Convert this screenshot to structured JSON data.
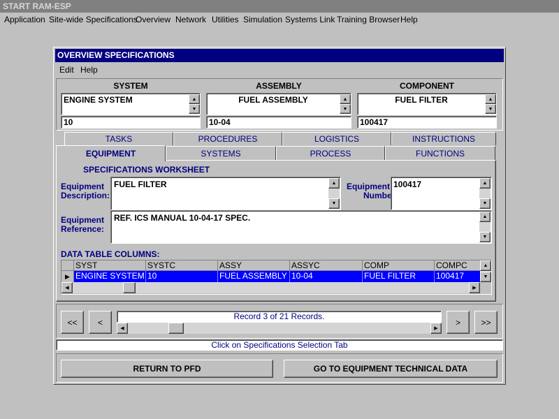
{
  "app": {
    "title": "START RAM-ESP"
  },
  "menu": [
    "Application",
    "Site-wide Specifications",
    "Overview",
    "Network",
    "Utilities",
    "Simulation",
    "Systems Link",
    "Training Browser",
    "Help"
  ],
  "window": {
    "title": "OVERVIEW SPECIFICATIONS",
    "menu": [
      "Edit",
      "Help"
    ]
  },
  "header": {
    "system": {
      "label": "SYSTEM",
      "name": "ENGINE SYSTEM",
      "code": "10"
    },
    "assembly": {
      "label": "ASSEMBLY",
      "name": "FUEL ASSEMBLY",
      "code": "10-04"
    },
    "component": {
      "label": "COMPONENT",
      "name": "FUEL FILTER",
      "code": "100417"
    }
  },
  "tabs_back": [
    "TASKS",
    "PROCEDURES",
    "LOGISTICS",
    "INSTRUCTIONS"
  ],
  "tabs_front": [
    "EQUIPMENT",
    "SYSTEMS",
    "PROCESS",
    "FUNCTIONS"
  ],
  "worksheet": {
    "title": "SPECIFICATIONS WORKSHEET",
    "equip_desc_label_1": "Equipment",
    "equip_desc_label_2": "Description:",
    "equip_desc_value": "FUEL FILTER",
    "equip_num_label_1": "Equipment",
    "equip_num_label_2": "Number:",
    "equip_num_value": "100417",
    "equip_ref_label_1": "Equipment",
    "equip_ref_label_2": "Reference:",
    "equip_ref_value": "REF. ICS MANUAL 10-04-17 SPEC."
  },
  "data_table": {
    "title": "DATA TABLE COLUMNS:",
    "columns": [
      "SYST",
      "SYSTC",
      "ASSY",
      "ASSYC",
      "COMP",
      "COMPC"
    ],
    "row": [
      "ENGINE SYSTEM",
      "10",
      "FUEL ASSEMBLY",
      "10-04",
      "FUEL FILTER",
      "100417"
    ]
  },
  "navigator": {
    "first": "<<",
    "prev": "<",
    "next": ">",
    "last": ">>",
    "record_text": "Record 3 of 21 Records.",
    "position_fraction": 0.14
  },
  "status": {
    "text": "Click on Specifications Selection Tab"
  },
  "buttons": {
    "return": "RETURN TO PFD",
    "goto": "GO TO EQUIPMENT TECHNICAL DATA"
  },
  "colors": {
    "selection": "#0000ff",
    "title_bar": "#000080",
    "label_text": "#000080"
  }
}
